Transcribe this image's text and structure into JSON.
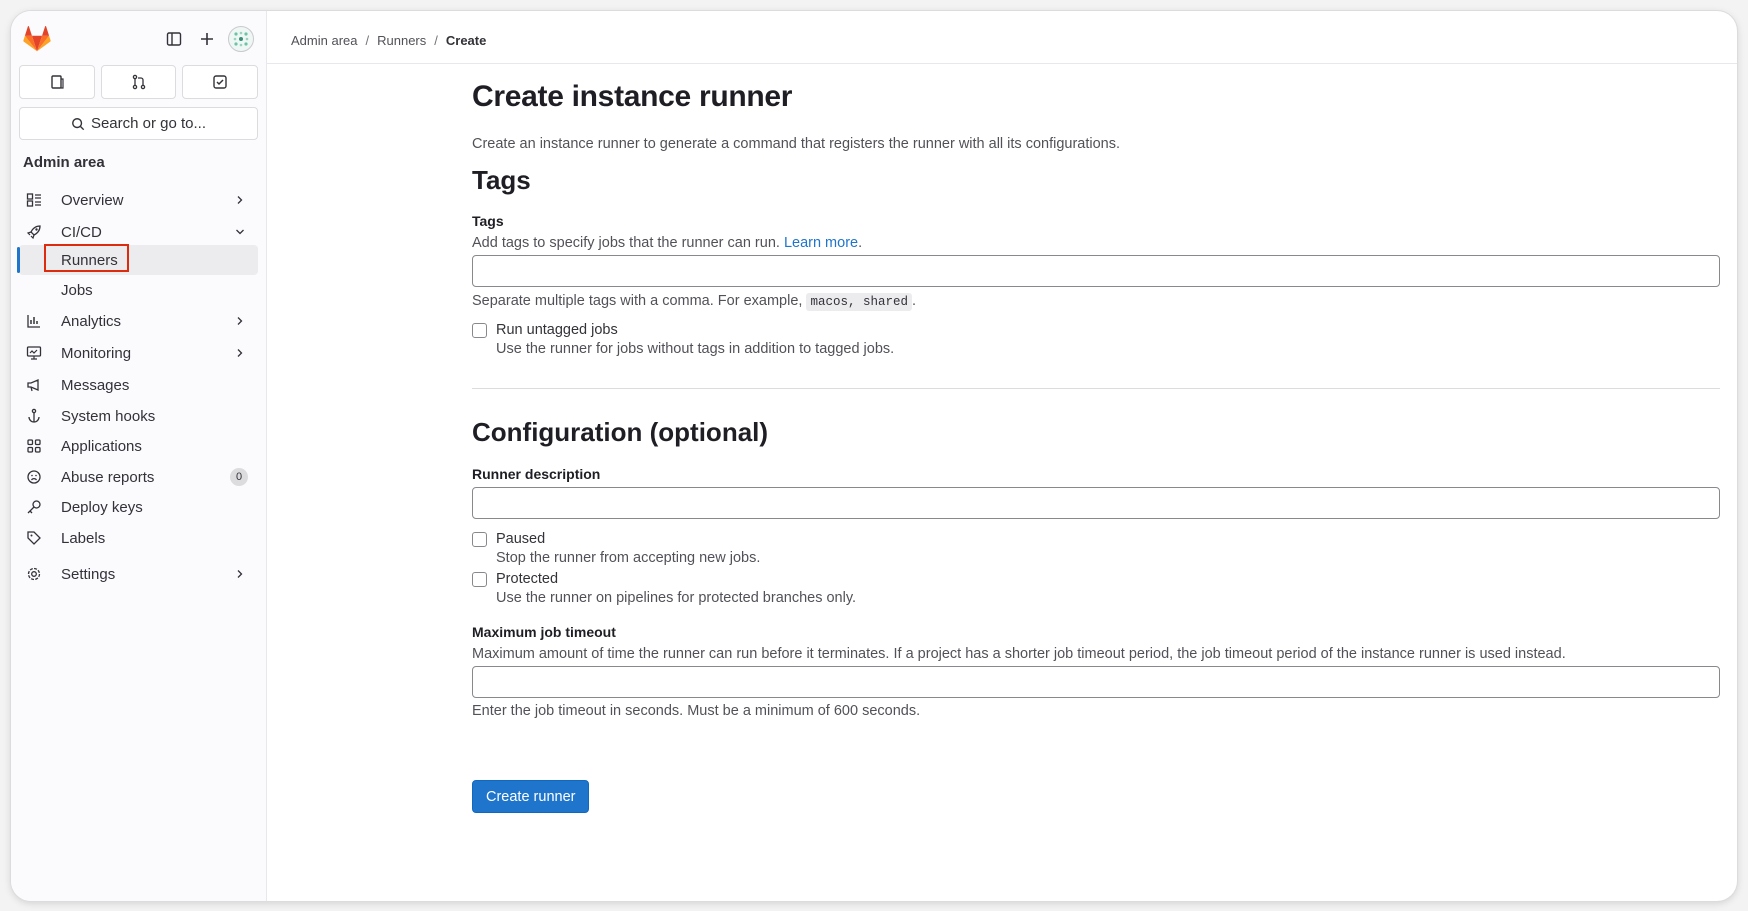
{
  "sidebar": {
    "search_label": "Search or go to...",
    "section_title": "Admin area",
    "items": [
      {
        "label": "Overview"
      },
      {
        "label": "CI/CD"
      },
      {
        "label": "Runners"
      },
      {
        "label": "Jobs"
      },
      {
        "label": "Analytics"
      },
      {
        "label": "Monitoring"
      },
      {
        "label": "Messages"
      },
      {
        "label": "System hooks"
      },
      {
        "label": "Applications"
      },
      {
        "label": "Abuse reports",
        "badge": "0"
      },
      {
        "label": "Deploy keys"
      },
      {
        "label": "Labels"
      },
      {
        "label": "Settings"
      }
    ]
  },
  "breadcrumb": {
    "items": [
      "Admin area",
      "Runners"
    ],
    "current": "Create",
    "separator": "/"
  },
  "page": {
    "title": "Create instance runner",
    "description": "Create an instance runner to generate a command that registers the runner with all its configurations."
  },
  "tags_section": {
    "heading": "Tags",
    "field_label": "Tags",
    "help_text": "Add tags to specify jobs that the runner can run.",
    "learn_more": "Learn more",
    "learn_more_suffix": ".",
    "tags_value": "",
    "separator_help": "Separate multiple tags with a comma. For example,",
    "example_code": "macos, shared",
    "example_suffix": ".",
    "untagged_checkbox": {
      "label": "Run untagged jobs",
      "description": "Use the runner for jobs without tags in addition to tagged jobs.",
      "checked": false
    }
  },
  "config_section": {
    "heading": "Configuration (optional)",
    "description_label": "Runner description",
    "description_value": "",
    "paused_checkbox": {
      "label": "Paused",
      "description": "Stop the runner from accepting new jobs.",
      "checked": false
    },
    "protected_checkbox": {
      "label": "Protected",
      "description": "Use the runner on pipelines for protected branches only.",
      "checked": false
    },
    "timeout_label": "Maximum job timeout",
    "timeout_help": "Maximum amount of time the runner can run before it terminates. If a project has a shorter job timeout period, the job timeout period of the instance runner is used instead.",
    "timeout_value": "",
    "timeout_note": "Enter the job timeout in seconds. Must be a minimum of 600 seconds."
  },
  "actions": {
    "submit_label": "Create runner"
  },
  "colors": {
    "accent": "#1f75cb",
    "highlight": "#dd2b0e",
    "brand": "#fc6d26"
  },
  "icons": {
    "logo": "gitlab-tanuki-icon",
    "sidebar_toggle": "sidebar-toggle-icon",
    "new": "plus-icon",
    "avatar": "user-avatar-icon",
    "issues": "issues-icon",
    "merge_requests": "merge-request-icon",
    "todos": "todo-checkbox-icon",
    "search": "search-icon"
  }
}
